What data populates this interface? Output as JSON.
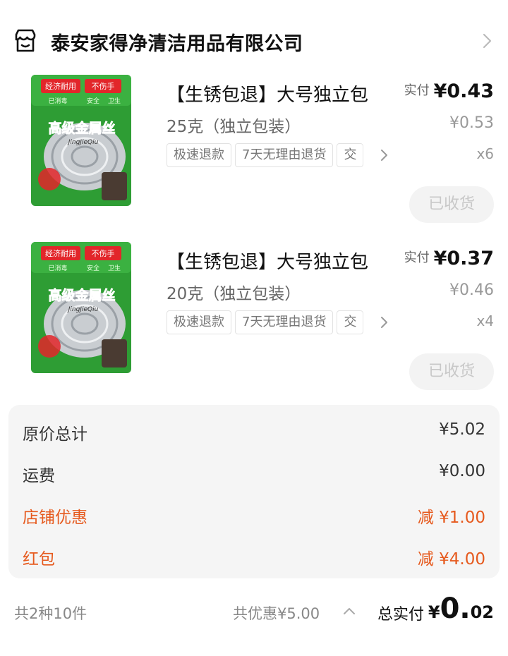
{
  "shop": {
    "name": "泰安家得净清洁用品有限公司",
    "icon": "shop-icon"
  },
  "items": [
    {
      "title": "【生锈包退】大号独立包",
      "spec": "25克（独立包装）",
      "tags": [
        "极速退款",
        "7天无理由退货",
        "交"
      ],
      "paid_label": "实付",
      "paid_price": "¥0.43",
      "original_price": "¥0.53",
      "quantity": "x6",
      "status_button": "已收货",
      "image_text": [
        "经济耐用",
        "不伤手",
        "已消毒",
        "安全",
        "卫生",
        "高级金属丝",
        "JingJieQiu"
      ]
    },
    {
      "title": "【生锈包退】大号独立包",
      "spec": "20克（独立包装）",
      "tags": [
        "极速退款",
        "7天无理由退货",
        "交"
      ],
      "paid_label": "实付",
      "paid_price": "¥0.37",
      "original_price": "¥0.46",
      "quantity": "x4",
      "status_button": "已收货",
      "image_text": [
        "经济耐用",
        "不伤手",
        "已消毒",
        "安全",
        "卫生",
        "高级金属丝",
        "JingJieQiu"
      ]
    }
  ],
  "summary": {
    "original_total_label": "原价总计",
    "original_total_value": "¥5.02",
    "shipping_label": "运费",
    "shipping_value": "¥0.00",
    "shop_discount_label": "店铺优惠",
    "shop_discount_value": "减 ¥1.00",
    "red_packet_label": "红包",
    "red_packet_value": "减 ¥4.00"
  },
  "footer": {
    "count": "共2种10件",
    "total_discount": "共优惠¥5.00",
    "total_paid_label": "总实付",
    "total_currency": "¥",
    "total_integer": "0.",
    "total_decimal": "02"
  },
  "colors": {
    "promo": "#e65a1e",
    "package_green": "#2e9d34",
    "package_red": "#e2262a"
  }
}
